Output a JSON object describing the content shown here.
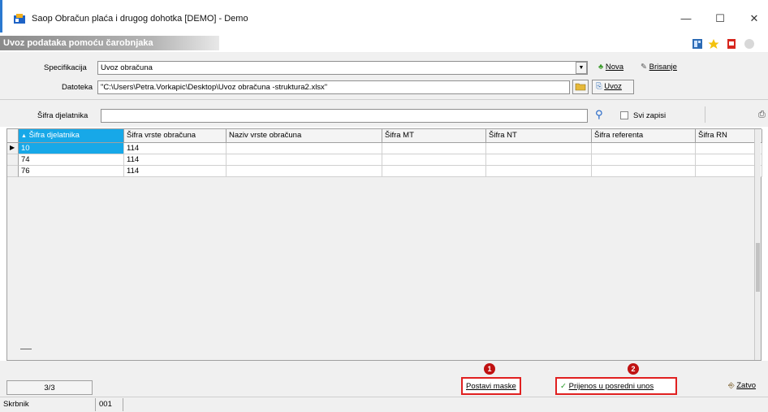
{
  "window": {
    "title": "Saop Obračun plaća i drugog dohotka [DEMO] - Demo",
    "minimize": "—",
    "maximize": "☐",
    "close": "✕"
  },
  "form": {
    "caption": "Uvoz podataka pomoću čarobnjaka"
  },
  "spec": {
    "label": "Specifikacija",
    "value": "Uvoz obračuna",
    "new_label": "Nova",
    "delete_label": "Brisanje"
  },
  "file": {
    "label": "Datoteka",
    "value": "\"C:\\Users\\Petra.Vorkapic\\Desktop\\Uvoz obračuna -struktura2.xlsx\"",
    "import_label": "Uvoz"
  },
  "search": {
    "label": "Šifra djelatnika",
    "value": "",
    "all_records_label": "Svi zapisi"
  },
  "grid": {
    "columns": [
      "Šifra djelatnika",
      "Šifra vrste obračuna",
      "Naziv vrste obračuna",
      "Šifra MT",
      "Šifra NT",
      "Šifra referenta",
      "Šifra RN"
    ],
    "rows": [
      [
        "10",
        "114",
        "",
        "",
        "",
        "",
        ""
      ],
      [
        "74",
        "114",
        "",
        "",
        "",
        "",
        ""
      ],
      [
        "76",
        "114",
        "",
        "",
        "",
        "",
        ""
      ]
    ]
  },
  "footer": {
    "counter": "3/3",
    "set_masks_label": "Postavi maske",
    "transfer_label": "Prijenos u posredni unos",
    "close_label": "Zatvo",
    "badge1": "1",
    "badge2": "2"
  },
  "status": {
    "user": "Skrbnik",
    "code": "001"
  },
  "colors": {
    "selection": "#17a8e8",
    "highlight_border": "#e02020",
    "badge": "#c01212"
  }
}
